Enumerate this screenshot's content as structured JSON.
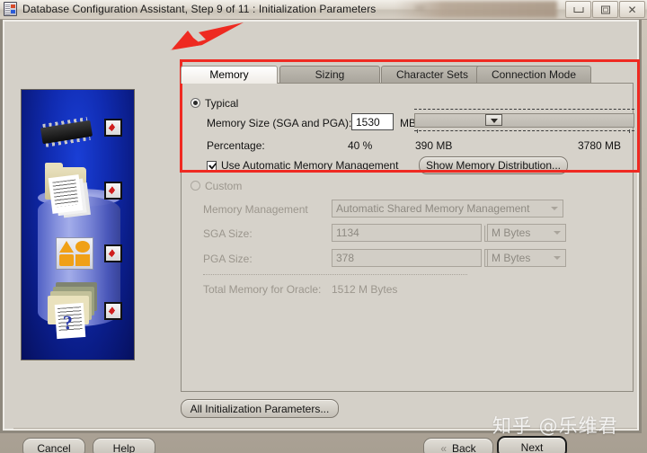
{
  "window": {
    "title": "Database Configuration Assistant, Step 9 of 11 : Initialization Parameters",
    "icon": "database-assistant-icon",
    "controls": {
      "minimize": "–",
      "maximize": "□",
      "close": "✕"
    }
  },
  "tabs": [
    {
      "label": "Memory",
      "selected": true
    },
    {
      "label": "Sizing",
      "selected": false
    },
    {
      "label": "Character Sets",
      "selected": false
    },
    {
      "label": "Connection Mode",
      "selected": false
    }
  ],
  "memory_tab": {
    "typical": {
      "radio_label": "Typical",
      "selected": true,
      "memory_size_label": "Memory Size (SGA and PGA):",
      "memory_size_value": "1530",
      "memory_size_unit": "MB",
      "percentage_label": "Percentage:",
      "percentage_value": "40 %",
      "slider_min": "390 MB",
      "slider_max": "3780 MB",
      "slider_position_pct": 35,
      "amm_checkbox_label": "Use Automatic Memory Management",
      "amm_checked": true,
      "show_distribution_button": "Show Memory Distribution..."
    },
    "custom": {
      "radio_label": "Custom",
      "selected": false,
      "memory_management_label": "Memory Management",
      "memory_management_value": "Automatic Shared Memory Management",
      "sga_label": "SGA Size:",
      "sga_value": "1134",
      "sga_unit": "M Bytes",
      "pga_label": "PGA Size:",
      "pga_value": "378",
      "pga_unit": "M Bytes",
      "total_label": "Total Memory for Oracle:",
      "total_value": "1512 M Bytes"
    },
    "all_params_button": "All Initialization Parameters..."
  },
  "footer": {
    "cancel": "Cancel",
    "help": "Help",
    "back": "Back",
    "back_icon": "«",
    "next": "Next"
  },
  "annotations": {
    "highlight_color": "#ef2a22",
    "arrow_target": "Memory tab",
    "watermark": "知乎 @乐维君"
  }
}
